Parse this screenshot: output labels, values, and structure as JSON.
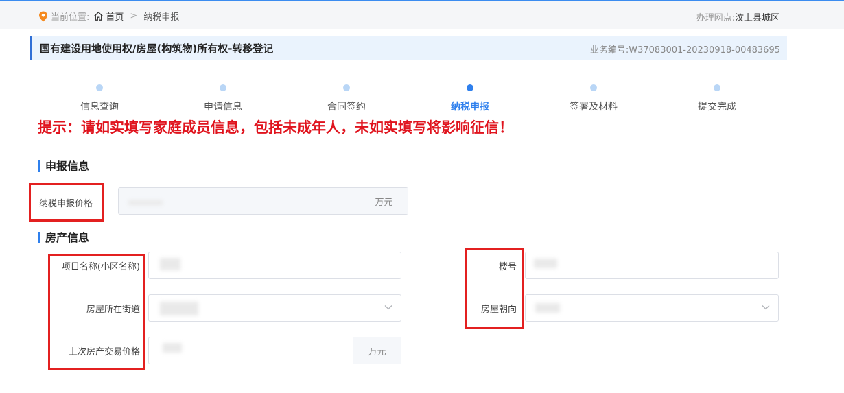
{
  "breadcrumb": {
    "prefix": "当前位置:",
    "home": "首页",
    "separator": ">",
    "current": "纳税申报"
  },
  "office": {
    "label": "办理网点:",
    "value": "汶上县城区"
  },
  "header": {
    "title": "国有建设用地使用权/房屋(构筑物)所有权-转移登记",
    "business_no_label": "业务编号:",
    "business_no": "W37083001-20230918-00483695"
  },
  "steps": [
    {
      "label": "信息查询",
      "active": false
    },
    {
      "label": "申请信息",
      "active": false
    },
    {
      "label": "合同签约",
      "active": false
    },
    {
      "label": "纳税申报",
      "active": true
    },
    {
      "label": "签署及材料",
      "active": false
    },
    {
      "label": "提交完成",
      "active": false
    }
  ],
  "warning": "提示：请如实填写家庭成员信息，包括未成年人，未如实填写将影响征信！",
  "declare": {
    "section_title": "申报信息",
    "price_label": "纳税申报价格",
    "price_unit": "万元"
  },
  "property": {
    "section_title": "房产信息",
    "project_label": "项目名称(小区名称)",
    "building_label": "楼号",
    "street_label": "房屋所在街道",
    "orientation_label": "房屋朝向",
    "last_price_label": "上次房产交易价格",
    "last_price_unit": "万元"
  },
  "colors": {
    "accent": "#2f80ed",
    "warning": "#e0141e",
    "annotation": "#e32020"
  }
}
